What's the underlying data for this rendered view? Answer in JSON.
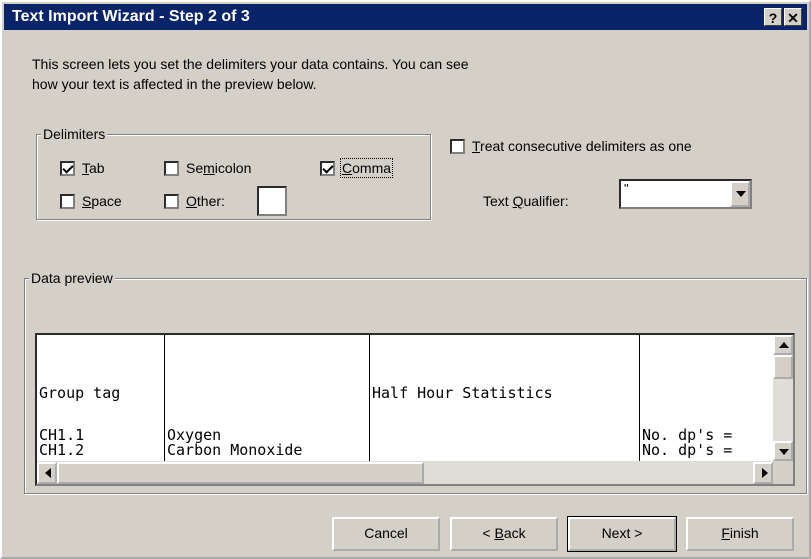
{
  "window": {
    "title": "Text Import Wizard - Step 2 of 3",
    "help_glyph": "?",
    "close_glyph": "✕"
  },
  "intro": {
    "line1": "This screen lets you set the delimiters your data contains.  You can see",
    "line2": "how your text is affected in the preview below."
  },
  "delimiters": {
    "legend": "Delimiters",
    "tab": {
      "pre": "",
      "acc": "T",
      "post": "ab",
      "checked": true
    },
    "semicolon": {
      "pre": "Se",
      "acc": "m",
      "post": "icolon",
      "checked": false
    },
    "comma": {
      "pre": "",
      "acc": "C",
      "post": "omma",
      "checked": true
    },
    "space": {
      "pre": "",
      "acc": "S",
      "post": "pace",
      "checked": false
    },
    "other": {
      "pre": "",
      "acc": "O",
      "post": "ther:",
      "checked": false,
      "value": ""
    }
  },
  "consecutive": {
    "pre": "",
    "acc": "T",
    "post": "reat consecutive delimiters as one",
    "checked": false
  },
  "qualifier": {
    "pre": "Text ",
    "acc": "Q",
    "post": "ualifier:",
    "value": "\""
  },
  "preview": {
    "legend": "Data preview",
    "columns": [
      {
        "cells": [
          "",
          "",
          "",
          "Group tag",
          "",
          "CH1.1",
          "CH1.2"
        ]
      },
      {
        "cells": [
          "",
          "",
          "",
          "",
          "",
          "Oxygen",
          "Carbon Monoxide"
        ]
      },
      {
        "cells": [
          "",
          "",
          "",
          "Half Hour Statistics",
          "",
          "",
          ""
        ]
      },
      {
        "cells": [
          "",
          "",
          "",
          "",
          "",
          "No. dp's =",
          "No. dp's ="
        ]
      }
    ]
  },
  "buttons": {
    "cancel": {
      "pre": "Cancel",
      "acc": "",
      "post": ""
    },
    "back": {
      "pre": "< ",
      "acc": "B",
      "post": "ack"
    },
    "next": {
      "pre": "Next >",
      "acc": "",
      "post": ""
    },
    "finish": {
      "pre": "",
      "acc": "F",
      "post": "inish"
    }
  }
}
